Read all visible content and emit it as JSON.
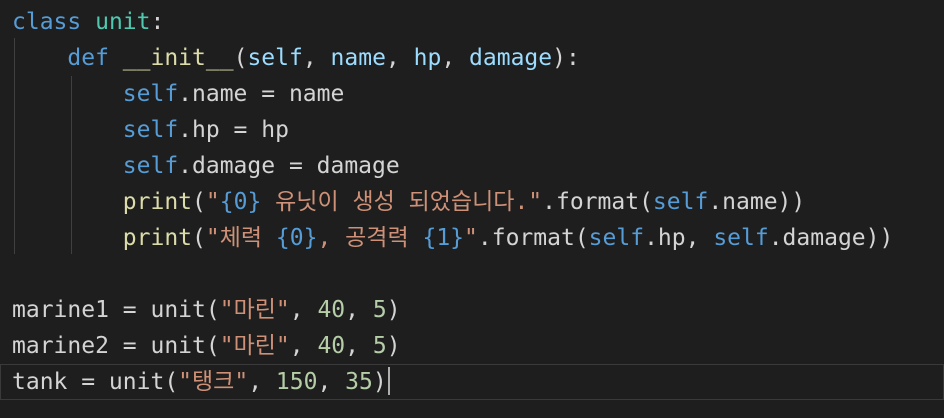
{
  "colors": {
    "background": "#1e1e1e",
    "keyword": "#569cd6",
    "class_name": "#4ec9b0",
    "function": "#dcdcaa",
    "parameter": "#9cdcfe",
    "string": "#ce9178",
    "number": "#b5cea8",
    "default": "#d4d4d4",
    "indent_guide": "#404040",
    "current_line_border": "#3a3a3a",
    "cursor": "#aeafad"
  },
  "lines": [
    [
      {
        "text": "class",
        "type": "keyword"
      },
      {
        "text": " ",
        "type": "default"
      },
      {
        "text": "unit",
        "type": "class_name"
      },
      {
        "text": ":",
        "type": "default"
      }
    ],
    [
      {
        "text": "    ",
        "type": "default"
      },
      {
        "text": "def",
        "type": "keyword"
      },
      {
        "text": " ",
        "type": "default"
      },
      {
        "text": "__init__",
        "type": "function"
      },
      {
        "text": "(",
        "type": "default"
      },
      {
        "text": "self",
        "type": "parameter"
      },
      {
        "text": ", ",
        "type": "default"
      },
      {
        "text": "name",
        "type": "parameter"
      },
      {
        "text": ", ",
        "type": "default"
      },
      {
        "text": "hp",
        "type": "parameter"
      },
      {
        "text": ", ",
        "type": "default"
      },
      {
        "text": "damage",
        "type": "parameter"
      },
      {
        "text": "):",
        "type": "default"
      }
    ],
    [
      {
        "text": "        ",
        "type": "default"
      },
      {
        "text": "self",
        "type": "keyword"
      },
      {
        "text": ".name = name",
        "type": "default"
      }
    ],
    [
      {
        "text": "        ",
        "type": "default"
      },
      {
        "text": "self",
        "type": "keyword"
      },
      {
        "text": ".hp = hp",
        "type": "default"
      }
    ],
    [
      {
        "text": "        ",
        "type": "default"
      },
      {
        "text": "self",
        "type": "keyword"
      },
      {
        "text": ".damage = damage",
        "type": "default"
      }
    ],
    [
      {
        "text": "        ",
        "type": "default"
      },
      {
        "text": "print",
        "type": "function"
      },
      {
        "text": "(",
        "type": "default"
      },
      {
        "text": "\"",
        "type": "string"
      },
      {
        "text": "{0}",
        "type": "keyword"
      },
      {
        "text": " 유닛이 생성 되었습니다.\"",
        "type": "string"
      },
      {
        "text": ".format(",
        "type": "default"
      },
      {
        "text": "self",
        "type": "keyword"
      },
      {
        "text": ".name))",
        "type": "default"
      }
    ],
    [
      {
        "text": "        ",
        "type": "default"
      },
      {
        "text": "print",
        "type": "function"
      },
      {
        "text": "(",
        "type": "default"
      },
      {
        "text": "\"체력 ",
        "type": "string"
      },
      {
        "text": "{0}",
        "type": "keyword"
      },
      {
        "text": ", 공격력 ",
        "type": "string"
      },
      {
        "text": "{1}",
        "type": "keyword"
      },
      {
        "text": "\"",
        "type": "string"
      },
      {
        "text": ".format(",
        "type": "default"
      },
      {
        "text": "self",
        "type": "keyword"
      },
      {
        "text": ".hp, ",
        "type": "default"
      },
      {
        "text": "self",
        "type": "keyword"
      },
      {
        "text": ".damage))",
        "type": "default"
      }
    ],
    [],
    [
      {
        "text": "marine1 = unit(",
        "type": "default"
      },
      {
        "text": "\"마린\"",
        "type": "string"
      },
      {
        "text": ", ",
        "type": "default"
      },
      {
        "text": "40",
        "type": "number"
      },
      {
        "text": ", ",
        "type": "default"
      },
      {
        "text": "5",
        "type": "number"
      },
      {
        "text": ")",
        "type": "default"
      }
    ],
    [
      {
        "text": "marine2 = unit(",
        "type": "default"
      },
      {
        "text": "\"마린\"",
        "type": "string"
      },
      {
        "text": ", ",
        "type": "default"
      },
      {
        "text": "40",
        "type": "number"
      },
      {
        "text": ", ",
        "type": "default"
      },
      {
        "text": "5",
        "type": "number"
      },
      {
        "text": ")",
        "type": "default"
      }
    ],
    [
      {
        "text": "tank = unit(",
        "type": "default"
      },
      {
        "text": "\"탱크\"",
        "type": "string"
      },
      {
        "text": ", ",
        "type": "default"
      },
      {
        "text": "150",
        "type": "number"
      },
      {
        "text": ", ",
        "type": "default"
      },
      {
        "text": "35",
        "type": "number"
      },
      {
        "text": ")",
        "type": "default"
      }
    ]
  ],
  "current_line": 10
}
